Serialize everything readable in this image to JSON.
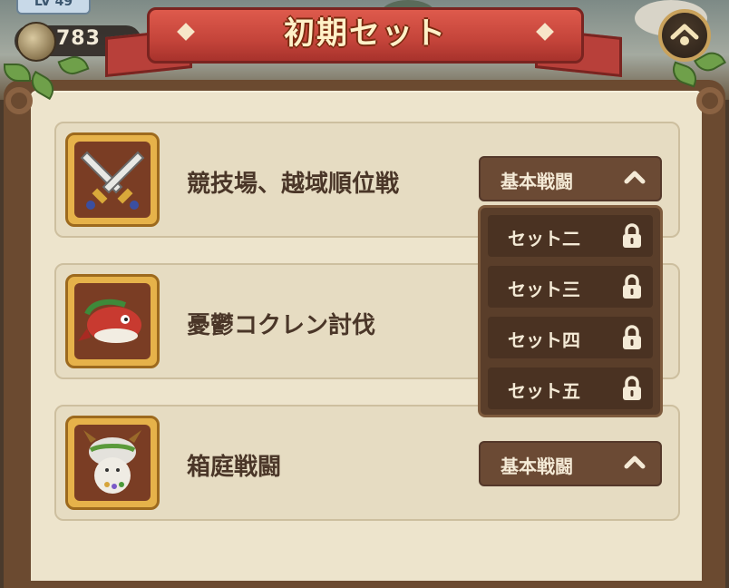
{
  "hud": {
    "level_label": "LV 49",
    "coin_value": "783",
    "home_icon": "home-icon"
  },
  "header": {
    "title": "初期セット"
  },
  "rows": [
    {
      "title": "競技場、越域順位戦",
      "icon": "crossed-swords-icon",
      "dropdown_label": "基本戦闘"
    },
    {
      "title": "憂鬱コクレン討伐",
      "icon": "red-whale-icon",
      "dropdown_label": ""
    },
    {
      "title": "箱庭戦闘",
      "icon": "mushroom-spirit-icon",
      "dropdown_label": "基本戦闘"
    }
  ],
  "dropdown": {
    "items": [
      "セット二",
      "セット三",
      "セット四",
      "セット五"
    ]
  },
  "colors": {
    "ribbon": "#c4443a",
    "panel": "#6b4a30",
    "parchment": "#ede4cc",
    "button": "#6b4a34"
  }
}
